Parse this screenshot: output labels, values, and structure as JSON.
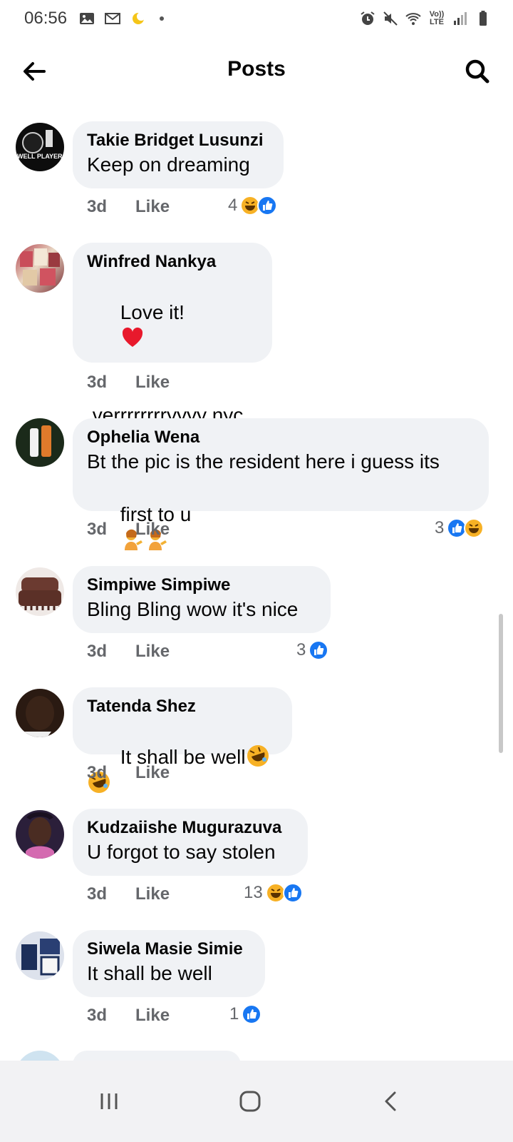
{
  "status_bar": {
    "time": "06:56",
    "left_icons": [
      "image-icon",
      "gmail-icon",
      "weather-moon-icon",
      "dot-icon"
    ],
    "right_icons": [
      "alarm-icon",
      "mute-icon",
      "wifi-icon",
      "volte-icon",
      "signal-icon",
      "battery-icon"
    ],
    "volte_label_top": "Vo))",
    "volte_label_bottom": "LTE"
  },
  "header": {
    "title": "Posts",
    "back_icon": "arrow-left-icon",
    "search_icon": "search-icon"
  },
  "comments": [
    {
      "name": "Takie Bridget Lusunzi",
      "text": "Keep on dreaming",
      "time": "3d",
      "like_label": "Like",
      "reaction_count": "4",
      "reactions": [
        "haha",
        "like"
      ],
      "avatar_colors": [
        "#111111",
        "#2b2b2b"
      ],
      "avatar_text": "WELL PLAYER"
    },
    {
      "name": "Winfred Nankya",
      "text": "Love it!",
      "text_extra": " verrrrrrrryyyy nyc",
      "time": "3d",
      "like_label": "Like",
      "reaction_count": "",
      "reactions": [],
      "avatar_colors": [
        "#b03a48",
        "#e9d8c4"
      ]
    },
    {
      "name": "Ophelia Wena",
      "text": "Bt the pic is the resident here i guess its",
      "text_line2": "first to u",
      "time": "3d",
      "like_label": "Like",
      "reaction_count": "3",
      "reactions": [
        "like",
        "haha"
      ],
      "avatar_colors": [
        "#1b2a1a",
        "#e07a2b"
      ]
    },
    {
      "name": "Simpiwe Simpiwe",
      "text": "Bling Bling wow it's nice",
      "time": "3d",
      "like_label": "Like",
      "reaction_count": "3",
      "reactions": [
        "like"
      ],
      "avatar_colors": [
        "#5b3027",
        "#8a4a3c"
      ]
    },
    {
      "name": "Tatenda Shez",
      "text": "It shall be well",
      "time": "3d",
      "like_label": "Like",
      "reaction_count": "",
      "reactions": [],
      "avatar_colors": [
        "#2a1a12",
        "#5a3a28"
      ]
    },
    {
      "name": "Kudzaiishe Mugurazuva",
      "text": "U forgot to say stolen",
      "time": "3d",
      "like_label": "Like",
      "reaction_count": "13",
      "reactions": [
        "haha",
        "like"
      ],
      "avatar_colors": [
        "#2b1f3a",
        "#d46ab0"
      ]
    },
    {
      "name": "Siwela Masie Simie",
      "text": "It shall be well",
      "time": "3d",
      "like_label": "Like",
      "reaction_count": "1",
      "reactions": [
        "like"
      ],
      "avatar_colors": [
        "#1c2f5a",
        "#eaeaea"
      ]
    }
  ],
  "nav_bar": {
    "icons": [
      "recent-apps-icon",
      "home-icon",
      "back-icon"
    ]
  },
  "colors": {
    "bubble": "#f0f2f5",
    "meta_text": "#65676b",
    "like_blue": "#1877f2",
    "haha_yellow": "#f7b125"
  }
}
